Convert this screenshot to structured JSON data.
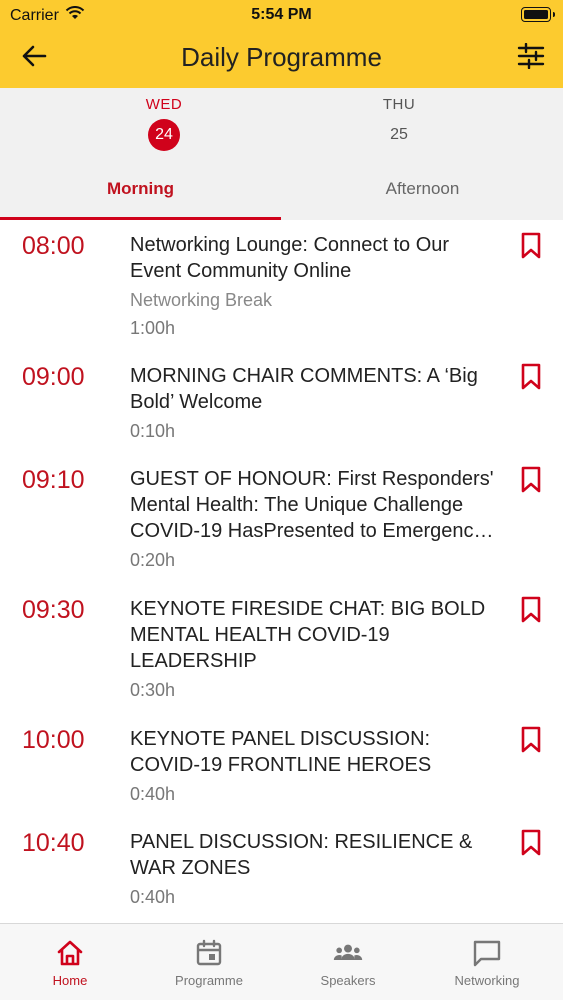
{
  "status": {
    "carrier": "Carrier",
    "time": "5:54 PM",
    "battery_level": 1.0
  },
  "nav": {
    "title": "Daily Programme"
  },
  "days": [
    {
      "name": "WED",
      "number": "24",
      "selected": true
    },
    {
      "name": "THU",
      "number": "25",
      "selected": false
    }
  ],
  "tabs": [
    {
      "label": "Morning",
      "selected": true
    },
    {
      "label": "Afternoon",
      "selected": false
    }
  ],
  "sessions": [
    {
      "time": "08:00",
      "title": "Networking Lounge: Connect to Our Event Community Online",
      "type": "Networking Break",
      "duration": "1:00h"
    },
    {
      "time": "09:00",
      "title": "MORNING CHAIR COMMENTS: A ‘Big Bold’ Welcome",
      "type": "",
      "duration": "0:10h"
    },
    {
      "time": "09:10",
      "title": "GUEST OF HONOUR: First Responders' Mental Health: The Unique Challenge COVID-19 HasPresented to Emergenc…",
      "type": "",
      "duration": "0:20h"
    },
    {
      "time": "09:30",
      "title": "KEYNOTE FIRESIDE CHAT:  BIG BOLD MENTAL HEALTH COVID-19 LEADERSHIP",
      "type": "",
      "duration": "0:30h"
    },
    {
      "time": "10:00",
      "title": "KEYNOTE PANEL DISCUSSION: COVID-19 FRONTLINE HEROES",
      "type": "",
      "duration": "0:40h"
    },
    {
      "time": "10:40",
      "title": "PANEL DISCUSSION: RESILIENCE & WAR ZONES",
      "type": "",
      "duration": "0:40h"
    }
  ],
  "tabbar": [
    {
      "label": "Home",
      "icon": "home-icon",
      "active": true
    },
    {
      "label": "Programme",
      "icon": "calendar-icon",
      "active": false
    },
    {
      "label": "Speakers",
      "icon": "people-icon",
      "active": false
    },
    {
      "label": "Networking",
      "icon": "chat-bubble-icon",
      "active": false
    }
  ],
  "colors": {
    "header": "#fccb2f",
    "accent": "#d0021b",
    "background": "#f1f1f1"
  }
}
